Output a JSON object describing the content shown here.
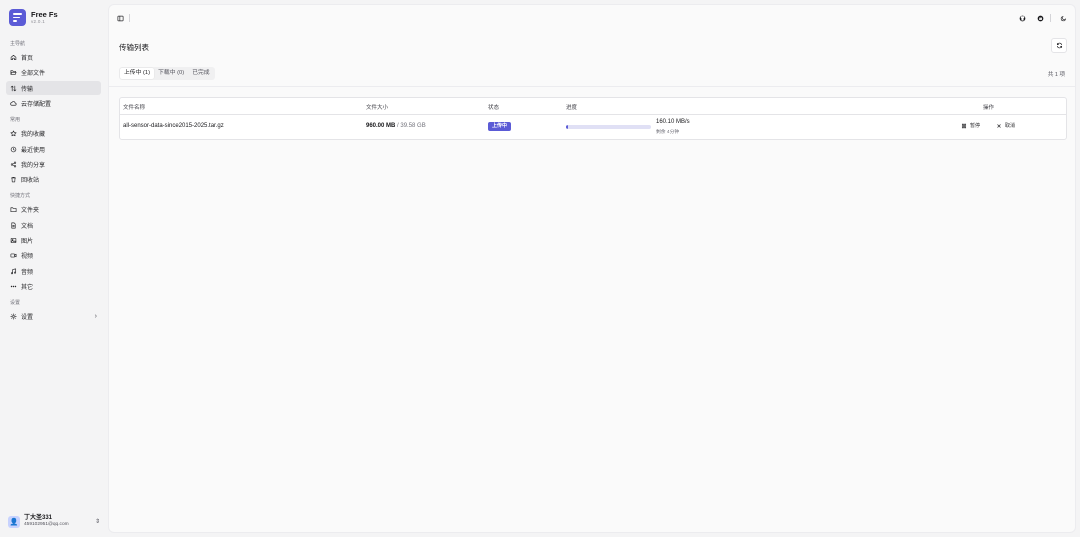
{
  "brand": {
    "name": "Free Fs",
    "version": "v2.0.1"
  },
  "nav": {
    "groups": [
      {
        "title": "主导航",
        "items": [
          {
            "label": "首页",
            "icon": "home-icon"
          },
          {
            "label": "全部文件",
            "icon": "folder-open-icon"
          },
          {
            "label": "传输",
            "icon": "transfer-icon",
            "active": true
          },
          {
            "label": "云存储配置",
            "icon": "cloud-icon"
          }
        ]
      },
      {
        "title": "常用",
        "items": [
          {
            "label": "我的收藏",
            "icon": "star-icon"
          },
          {
            "label": "最近使用",
            "icon": "clock-icon"
          },
          {
            "label": "我的分享",
            "icon": "share-icon"
          },
          {
            "label": "回收站",
            "icon": "trash-icon"
          }
        ]
      },
      {
        "title": "快捷方式",
        "items": [
          {
            "label": "文件夹",
            "icon": "folder-icon"
          },
          {
            "label": "文档",
            "icon": "document-icon"
          },
          {
            "label": "图片",
            "icon": "image-icon"
          },
          {
            "label": "视频",
            "icon": "video-icon"
          },
          {
            "label": "音频",
            "icon": "music-icon"
          },
          {
            "label": "其它",
            "icon": "more-icon"
          }
        ]
      },
      {
        "title": "设置",
        "items": [
          {
            "label": "设置",
            "icon": "gear-icon",
            "chevron": true
          }
        ]
      }
    ]
  },
  "user": {
    "name": "丁大圣331",
    "email": "459102951@qq.com"
  },
  "page": {
    "title": "传输列表",
    "count": "共 1 项"
  },
  "tabs": [
    {
      "label": "上传中 (1)",
      "active": true
    },
    {
      "label": "下载中 (0)"
    },
    {
      "label": "已完成"
    }
  ],
  "table": {
    "headers": {
      "name": "文件名称",
      "size": "文件大小",
      "status": "状态",
      "progress": "进度",
      "ops": "操作"
    },
    "rows": [
      {
        "name": "all-sensor-data-since2015-2025.tar.gz",
        "size": "960.00 MB",
        "size_sep": " / ",
        "total": "39.58 GB",
        "status": "上传中",
        "progress": 0.024,
        "speed": "160.10 MB/s",
        "remaining": "剩余 4分钟",
        "pause_label": "暂停",
        "cancel_label": "取消"
      }
    ]
  },
  "colors": {
    "accent": "#5b5bd6",
    "progress_track": "#e0e0f5"
  }
}
